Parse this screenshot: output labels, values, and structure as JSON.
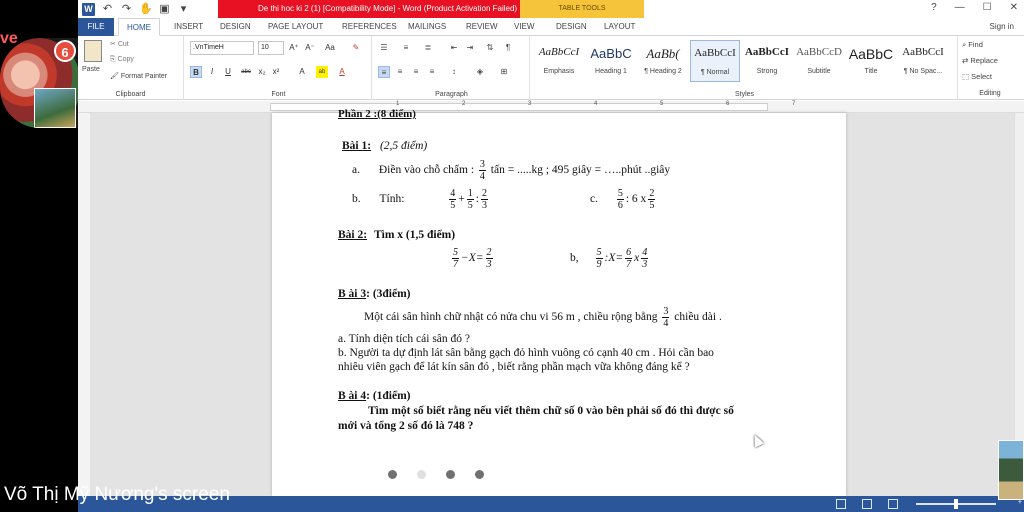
{
  "titlebar": {
    "title": "De thi hoc ki 2 (1) [Compatibility Mode] - Word (Product Activation Failed)",
    "table_tools": "TABLE TOOLS",
    "help": "?",
    "minimize": "—",
    "restore": "☐",
    "close": "✕"
  },
  "tabs": [
    "FILE",
    "HOME",
    "INSERT",
    "DESIGN",
    "PAGE LAYOUT",
    "REFERENCES",
    "MAILINGS",
    "REVIEW",
    "VIEW",
    "DESIGN",
    "LAYOUT"
  ],
  "signin": "Sign in",
  "ribbon": {
    "clipboard": {
      "paste": "Paste",
      "cut": "Cut",
      "copy": "Copy",
      "format_painter": "Format Painter",
      "label": "Clipboard"
    },
    "font": {
      "name": ".VnTimeH",
      "size": "10",
      "label": "Font",
      "buttons": [
        "B",
        "I",
        "U",
        "abc",
        "x₂",
        "x²",
        "A",
        "ab",
        "A"
      ]
    },
    "paragraph": {
      "label": "Paragraph"
    },
    "styles": {
      "label": "Styles",
      "items": [
        {
          "sample": "AaBbCcI",
          "name": "Emphasis"
        },
        {
          "sample": "AaBbC",
          "name": "Heading 1"
        },
        {
          "sample": "AaBb(",
          "name": "¶ Heading 2"
        },
        {
          "sample": "AaBbCcI",
          "name": "¶ Normal"
        },
        {
          "sample": "AaBbCcI",
          "name": "Strong"
        },
        {
          "sample": "AaBbCcD",
          "name": "Subtitle"
        },
        {
          "sample": "AaBbC",
          "name": "Title"
        },
        {
          "sample": "AaBbCcI",
          "name": "¶ No Spac..."
        }
      ]
    },
    "editing": {
      "find": "Find",
      "replace": "Replace",
      "select": "Select",
      "label": "Editing"
    }
  },
  "ruler_numbers": [
    "1",
    "2",
    "3",
    "4",
    "5",
    "6",
    "7"
  ],
  "doc": {
    "part_header": "Phần 2 :(8 điểm)",
    "bai1_title": "Bài 1:",
    "bai1_points": "(2,5  điểm)",
    "bai1_a_label": "a.",
    "bai1_a_text": "Điền vào chỗ chấm :",
    "bai1_a_frac_n": "3",
    "bai1_a_frac_d": "4",
    "bai1_a_rest": "tấn = .....kg    ;      495 giây  = …..phút ..giây",
    "bai1_b_label": "b.",
    "bai1_b_text": "Tính:",
    "bai1_c_label": "c.",
    "bai1_c_text": ":  6 x",
    "bai2_title": "Bài 2:",
    "bai2_rest": "Tìm x  (1,5 điểm)",
    "bai2_b_label": "b,",
    "bai3_title": "B ài 3",
    "bai3_points": ": (3điểm)",
    "bai3_text1": "Một cái sân hình chữ nhật có nửa chu vi 56 m , chiều rộng bằng",
    "bai3_text1_end": "chiều dài .",
    "bai3_a": "a. Tính diện tích cái sân đó ?",
    "bai3_b1": "b. Người ta dự định lát sân bằng gạch đỏ hình vuông có cạnh 40 cm . Hỏi cần bao",
    "bai3_b2": "nhiêu viên gạch để lát kín sân đó , biết rằng phần mạch vữa không đáng kể ?",
    "bai4_title": "B ài 4",
    "bai4_points": ": (1điểm)",
    "bai4_text1": "Tìm một số biết rằng nếu viết thêm chữ số 0 vào bên phải số đó thì được số",
    "bai4_text2": "mới và tổng 2 số đó là 748 ?"
  },
  "statusbar": {
    "zoom": "+"
  },
  "overlay": {
    "name_fragment": "ve",
    "notification_count": "6",
    "presenter_label": "Võ Thị Mỹ Nương's screen"
  },
  "colors": {
    "word_blue": "#2b579a",
    "title_red": "#e81123",
    "table_tools_yellow": "#f6c43a"
  }
}
